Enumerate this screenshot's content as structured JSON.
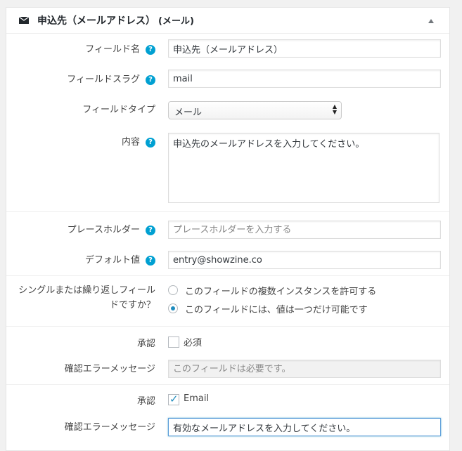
{
  "header": {
    "title": "申込先（メールアドレス）",
    "subtitle": "(メール)",
    "icon": "envelope-icon",
    "toggle_icon": "caret-up-icon"
  },
  "fields": {
    "field_name": {
      "label": "フィールド名",
      "value": "申込先（メールアドレス）"
    },
    "field_slug": {
      "label": "フィールドスラグ",
      "value": "mail"
    },
    "field_type": {
      "label": "フィールドタイプ",
      "selected": "メール"
    },
    "content": {
      "label": "内容",
      "value": "申込先のメールアドレスを入力してください。"
    },
    "placeholder": {
      "label": "プレースホルダー",
      "placeholder": "プレースホルダーを入力する"
    },
    "default_value": {
      "label": "デフォルト値",
      "value": "entry@showzine.co"
    },
    "single_repeat": {
      "label_line1": "シングルまたは繰り返しフィール",
      "label_line2": "ドですか？",
      "options": [
        "このフィールドの複数インスタンスを許可する",
        "このフィールドには、値は一つだけ可能です"
      ],
      "selected_index": 1
    },
    "approval1": {
      "label": "承認",
      "checkbox_label": "必須",
      "checked": false
    },
    "confirm_error1": {
      "label": "確認エラーメッセージ",
      "placeholder": "このフィールドは必要です。"
    },
    "approval2": {
      "label": "承認",
      "checkbox_label": "Email",
      "checked": true
    },
    "confirm_error2": {
      "label": "確認エラーメッセージ",
      "value": "有効なメールアドレスを入力してください。"
    }
  },
  "help_glyph": "?",
  "colors": {
    "accent": "#00a0d2",
    "check": "#1e8cbe",
    "focus": "#5b9dd9"
  }
}
